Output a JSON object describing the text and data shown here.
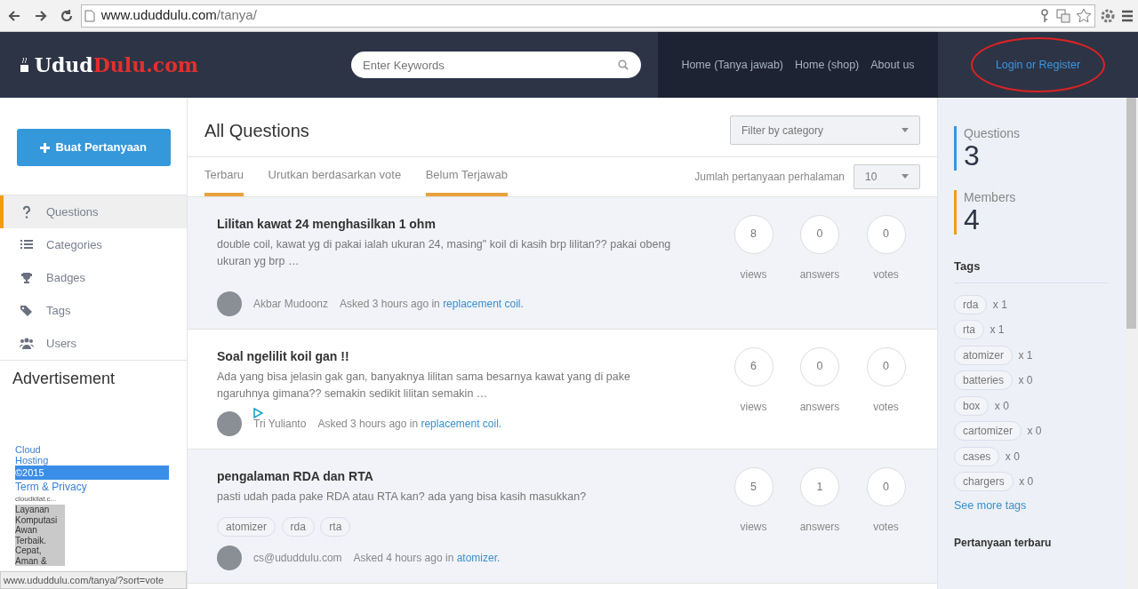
{
  "browser": {
    "url_host": "www.ududdulu.com",
    "url_path": "/tanya/"
  },
  "header": {
    "logo": {
      "first": "Udud",
      "second": "Dulu.com"
    },
    "search": {
      "placeholder": "Enter Keywords"
    },
    "nav": [
      {
        "label": "Home (Tanya jawab)"
      },
      {
        "label": "Home (shop)"
      },
      {
        "label": "About us"
      }
    ],
    "login": "Login or Register"
  },
  "sidebar": {
    "create_button": "Buat Pertanyaan",
    "items": [
      {
        "label": "Questions",
        "selected": true
      },
      {
        "label": "Categories",
        "selected": false
      },
      {
        "label": "Badges",
        "selected": false
      },
      {
        "label": "Tags",
        "selected": false
      },
      {
        "label": "Users",
        "selected": false
      }
    ],
    "ad_heading": "Advertisement",
    "ad": {
      "link": "Cloud Hosting",
      "copyright": "©2015",
      "terms": "Term & Privacy",
      "domain": "cloudkilat.c...",
      "text": "Layanan Komputasi Awan Terbaik. Cepat, Aman &"
    }
  },
  "main": {
    "title": "All Questions",
    "filter": {
      "placeholder": "Filter by category"
    },
    "tabs": [
      {
        "label": "Terbaru",
        "selected": true
      },
      {
        "label": "Urutkan berdasarkan vote",
        "selected": false
      },
      {
        "label": "Belum Terjawab",
        "selected": true
      }
    ],
    "per_page": {
      "label": "Jumlah pertanyaan perhalaman",
      "value": "10"
    },
    "questions": [
      {
        "title": "Lilitan kawat 24 menghasilkan 1 ohm",
        "excerpt": "double coil, kawat yg di pakai ialah ukuran 24, masing\" koil di kasih brp lilitan?? pakai obeng ukuran yg brp …",
        "author": "Akbar Mudoonz",
        "asked": "Asked 3 hours ago in",
        "category": "replacement coil.",
        "stats": [
          {
            "value": "8",
            "label": "views"
          },
          {
            "value": "0",
            "label": "answers"
          },
          {
            "value": "0",
            "label": "votes"
          }
        ],
        "shaded": true
      },
      {
        "title": "Soal ngelilit koil gan !!",
        "excerpt": "Ada yang bisa jelasin gak gan, banyaknya lilitan sama besarnya kawat yang di pake ngaruhnya gimana?? semakin sedikit lilitan semakin …",
        "author": "Tri Yulianto",
        "asked": "Asked 3 hours ago in",
        "category": "replacement coil.",
        "stats": [
          {
            "value": "6",
            "label": "views"
          },
          {
            "value": "0",
            "label": "answers"
          },
          {
            "value": "0",
            "label": "votes"
          }
        ],
        "shaded": false
      },
      {
        "title": "pengalaman RDA dan RTA",
        "excerpt": "pasti udah pada pake RDA atau RTA kan? ada yang bisa kasih masukkan?",
        "tags": [
          "atomizer",
          "rda",
          "rta"
        ],
        "author": "cs@ududdulu.com",
        "asked": "Asked 4 hours ago in",
        "category": "atomizer.",
        "stats": [
          {
            "value": "5",
            "label": "views"
          },
          {
            "value": "1",
            "label": "answers"
          },
          {
            "value": "0",
            "label": "votes"
          }
        ],
        "shaded": true
      }
    ]
  },
  "right": {
    "stats": [
      {
        "label": "Questions",
        "value": "3",
        "color": "#3498db"
      },
      {
        "label": "Members",
        "value": "4",
        "color": "#f39c12"
      }
    ],
    "tags_heading": "Tags",
    "tags": [
      {
        "name": "rda",
        "count": "x 1"
      },
      {
        "name": "rta",
        "count": "x 1"
      },
      {
        "name": "atomizer",
        "count": "x 1"
      },
      {
        "name": "batteries",
        "count": "x 0"
      },
      {
        "name": "box",
        "count": "x 0"
      },
      {
        "name": "cartomizer",
        "count": "x 0"
      },
      {
        "name": "cases",
        "count": "x 0"
      },
      {
        "name": "chargers",
        "count": "x 0"
      }
    ],
    "see_more": "See more tags",
    "recent_heading": "Pertanyaan terbaru"
  },
  "status_bar": "www.ududdulu.com/tanya/?sort=vote"
}
